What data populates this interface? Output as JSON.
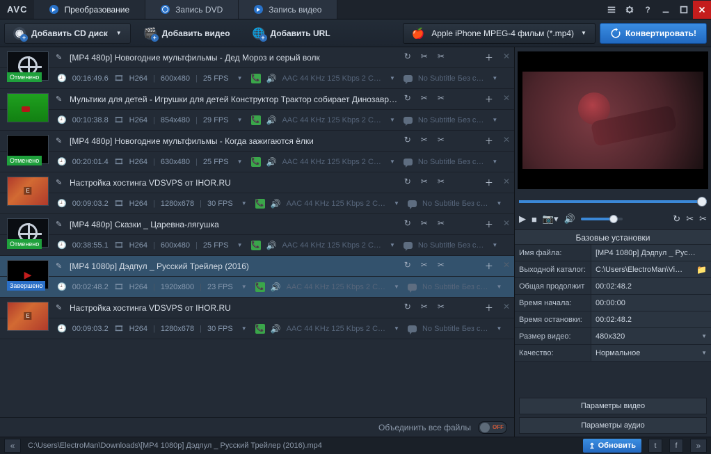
{
  "app": {
    "logo": "AVC"
  },
  "tabs": [
    {
      "label": "Преобразование",
      "active": true,
      "icon": "arrow"
    },
    {
      "label": "Запись DVD",
      "active": false,
      "icon": "disc"
    },
    {
      "label": "Запись видео",
      "active": false,
      "icon": "arrow"
    }
  ],
  "toolbar": {
    "add_cd": "Добавить CD диск",
    "add_video": "Добавить видео",
    "add_url": "Добавить URL",
    "profile": "Apple iPhone MPEG-4 фильм (*.mp4)",
    "convert": "Конвертировать!"
  },
  "items": [
    {
      "title": "[MP4 480p] Новогодние мультфильмы - Дед Мороз и серый волк",
      "thumb": "reel",
      "status": "Отменено",
      "status_kind": "cancel",
      "checked": false,
      "duration": "00:16:49.6",
      "codec": "H264",
      "res": "600x480",
      "fps": "25 FPS",
      "audio": "AAC 44 KHz 125 Kbps 2 C…",
      "sub": "No Subtitle Без с…"
    },
    {
      "title": "Мультики для детей - Игрушки для детей Конструктор Трактор собирает Динозавр…",
      "thumb": "green",
      "status": "",
      "status_kind": "",
      "checked": true,
      "duration": "00:10:38.8",
      "codec": "H264",
      "res": "854x480",
      "fps": "29 FPS",
      "audio": "AAC 44 KHz 125 Kbps 2 C…",
      "sub": "No Subtitle Без с…"
    },
    {
      "title": "[MP4 480p] Новогодние мультфильмы - Когда зажигаются ёлки",
      "thumb": "dark",
      "status": "Отменено",
      "status_kind": "cancel",
      "checked": false,
      "duration": "00:20:01.4",
      "codec": "H264",
      "res": "630x480",
      "fps": "25 FPS",
      "audio": "AAC 44 KHz 125 Kbps 2 C…",
      "sub": "No Subtitle Без с…"
    },
    {
      "title": "Настройка хостинга VDSVPS от IHOR.RU",
      "thumb": "poster",
      "status": "",
      "status_kind": "",
      "checked": true,
      "duration": "00:09:03.2",
      "codec": "H264",
      "res": "1280x678",
      "fps": "30 FPS",
      "audio": "AAC 44 KHz 125 Kbps 2 C…",
      "sub": "No Subtitle Без с…"
    },
    {
      "title": "[MP4 480p] Сказки _ Царевна-лягушка",
      "thumb": "reel",
      "status": "Отменено",
      "status_kind": "cancel",
      "checked": false,
      "duration": "00:38:55.1",
      "codec": "H264",
      "res": "600x480",
      "fps": "25 FPS",
      "audio": "AAC 44 KHz 125 Kbps 2 C…",
      "sub": "No Subtitle Без с…"
    },
    {
      "title": "[MP4 1080p] Дэдпул _ Русский Трейлер (2016)",
      "thumb": "trailer",
      "status": "Завершено",
      "status_kind": "done",
      "checked": true,
      "selected": true,
      "duration": "00:02:48.2",
      "codec": "H264",
      "res": "1920x800",
      "fps": "23 FPS",
      "audio": "AAC 44 KHz 125 Kbps 2 C…",
      "sub": "No Subtitle Без с…"
    },
    {
      "title": "Настройка хостинга VDSVPS от IHOR.RU",
      "thumb": "poster",
      "status": "",
      "status_kind": "",
      "checked": true,
      "duration": "00:09:03.2",
      "codec": "H264",
      "res": "1280x678",
      "fps": "30 FPS",
      "audio": "AAC 44 KHz 125 Kbps 2 C…",
      "sub": "No Subtitle Без с…"
    }
  ],
  "merge": {
    "label": "Объединить все файлы",
    "state": "OFF"
  },
  "settings": {
    "header": "Базовые установки",
    "rows": {
      "filename_k": "Имя файла:",
      "filename_v": "[MP4 1080p] Дэдпул _ Рус…",
      "outdir_k": "Выходной каталог:",
      "outdir_v": "C:\\Users\\ElectroMan\\Vi…",
      "totaldur_k": "Общая продолжит",
      "totaldur_v": "00:02:48.2",
      "start_k": "Время начала:",
      "start_v": "00:00:00",
      "stop_k": "Время остановки:",
      "stop_v": "00:02:48.2",
      "size_k": "Размер видео:",
      "size_v": "480x320",
      "quality_k": "Качество:",
      "quality_v": "Нормальное"
    },
    "video_params": "Параметры видео",
    "audio_params": "Параметры аудио"
  },
  "statusbar": {
    "path": "C:\\Users\\ElectroMan\\Downloads\\[MP4 1080p] Дэдпул _ Русский Трейлер (2016).mp4",
    "update": "Обновить"
  }
}
